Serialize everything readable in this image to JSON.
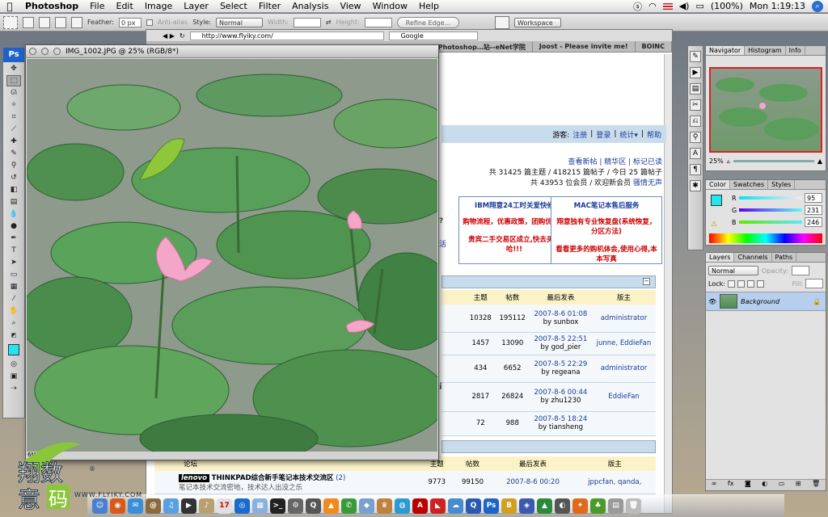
{
  "menubar": {
    "app": "Photoshop",
    "items": [
      "File",
      "Edit",
      "Image",
      "Layer",
      "Select",
      "Filter",
      "Analysis",
      "View",
      "Window",
      "Help"
    ],
    "battery": "(100%)",
    "clock": "Mon 1:19:13"
  },
  "options": {
    "feather_label": "Feather:",
    "feather_value": "0 px",
    "antialias_label": "Anti-alias",
    "style_label": "Style:",
    "style_value": "Normal",
    "width_label": "Width:",
    "height_label": "Height:",
    "refine_edge": "Refine Edge...",
    "workspace": "Workspace ▾"
  },
  "document": {
    "title": "IMG_1002.JPG @ 25% (RGB/8*)",
    "status": "6M/28M"
  },
  "browser": {
    "url": "http://www.flyiky.com/",
    "search": "Google",
    "tabs": [
      "Photoshop…站--eNet学院",
      "Joost - Please invite me!",
      "BOINC"
    ],
    "topbar": {
      "guest": "游客:",
      "links": [
        "注册",
        "登录",
        "统计▾",
        "帮助"
      ]
    },
    "stats": {
      "links": "查看新帖 | 精华区 | 标记已读",
      "line1": "共 31425 篇主题 / 418215 篇帖子 / 今日 25 篇帖子",
      "line2": "共 43953 位会员 / 欢迎新会员",
      "newmember": "骚情无声"
    },
    "promo": [
      {
        "title": "IBM翔意24工时关爱快修",
        "l1": "购物流程，优惠政策，团购优惠等",
        "l2": "贵宾二手交易区成立,快去买卖哈!!!"
      },
      {
        "title": "MAC笔记本售后服务",
        "l1": "翔意独有专业恢复盘(系统恢复，分区方法)",
        "l2": "看看更多的购机体会,使用心得,本本写真"
      }
    ],
    "partial": {
      "q": "?",
      "act": "活",
      "big": "最大"
    },
    "table1": {
      "headers": [
        "主题",
        "帖数",
        "最后发表",
        "版主"
      ],
      "rows": [
        [
          "10328",
          "195112",
          "2007-8-6 01:08",
          "by sunbox",
          "administrator"
        ],
        [
          "1457",
          "13090",
          "2007-8-5 22:51",
          "by god_pier",
          "junne, EddieFan"
        ],
        [
          "434",
          "6652",
          "2007-8-5 22:29",
          "by regeana",
          "administrator"
        ],
        [
          "2817",
          "26824",
          "2007-8-6 00:44",
          "by zhu1230",
          "EddieFan"
        ],
        [
          "72",
          "988",
          "2007-8-5 18:24",
          "by tiansheng",
          ""
        ]
      ]
    },
    "table2": {
      "headers": [
        "论坛",
        "主题",
        "帖数",
        "最后发表",
        "版主"
      ],
      "row": {
        "brand": "lenovo",
        "title": "THINKPAD综合新手笔记本技术交流区",
        "count": "(2)",
        "sub": "笔记本技术交流密地，技术达人出没之乐",
        "topics": "9773",
        "posts": "99150",
        "date": "2007-8-6 00:20",
        "mods": "jppcfan, qanda,"
      }
    }
  },
  "panels": {
    "navigator_tabs": [
      "Navigator",
      "Histogram",
      "Info"
    ],
    "zoom": "25%",
    "color_tabs": [
      "Color",
      "Swatches",
      "Styles"
    ],
    "rgb": {
      "R": "95",
      "G": "231",
      "B": "246"
    },
    "fg_color": "#24e4ef",
    "layers_tabs": [
      "Layers",
      "Channels",
      "Paths"
    ],
    "blend": "Normal",
    "opacity_label": "Opacity:",
    "lock_label": "Lock:",
    "fill_label": "Fill:",
    "layer_name": "Background"
  },
  "watermark": {
    "url": "WWW.FLYIKY.COM",
    "reg": "®"
  }
}
